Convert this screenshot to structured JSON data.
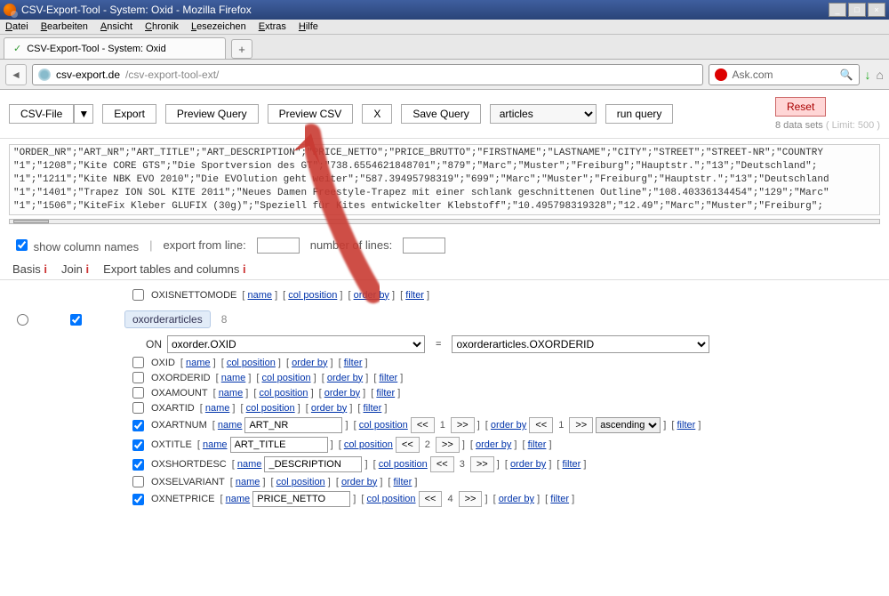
{
  "window_title": "CSV-Export-Tool - System: Oxid - Mozilla Firefox",
  "menu": [
    "Datei",
    "Bearbeiten",
    "Ansicht",
    "Chronik",
    "Lesezeichen",
    "Extras",
    "Hilfe"
  ],
  "tab_title": "CSV-Export-Tool - System: Oxid",
  "url_host": "csv-export.de",
  "url_path": "/csv-export-tool-ext/",
  "search_placeholder": "Ask.com",
  "toolbar": {
    "csv_file": "CSV-File",
    "export": "Export",
    "preview_query": "Preview Query",
    "preview_csv": "Preview CSV",
    "close_x": "X",
    "save_query": "Save Query",
    "target_select": "articles",
    "run_query": "run query",
    "reset": "Reset",
    "data_sets": "8 data sets",
    "limit": "( Limit: 500 )"
  },
  "csv_preview_lines": [
    "\"ORDER_NR\";\"ART_NR\";\"ART_TITLE\";\"ART_DESCRIPTION\";\"PRICE_NETTO\";\"PRICE_BRUTTO\";\"FIRSTNAME\";\"LASTNAME\";\"CITY\";\"STREET\";\"STREET-NR\";\"COUNTRY",
    "\"1\";\"1208\";\"Kite CORE GTS\";\"Die Sportversion des GT\";\"738.6554621848701\";\"879\";\"Marc\";\"Muster\";\"Freiburg\";\"Hauptstr.\";\"13\";\"Deutschland\";",
    "\"1\";\"1211\";\"Kite NBK EVO 2010\";\"Die EVOlution geht weiter\";\"587.39495798319\";\"699\";\"Marc\";\"Muster\";\"Freiburg\";\"Hauptstr.\";\"13\";\"Deutschland",
    "\"1\";\"1401\";\"Trapez ION SOL KITE 2011\";\"Neues Damen Freestyle-Trapez mit einer schlank geschnittenen Outline\";\"108.40336134454\";\"129\";\"Marc\"",
    "\"1\";\"1506\";\"KiteFix Kleber GLUFIX (30g)\";\"Speziell für Kites entwickelter Klebstoff\";\"10.495798319328\";\"12.49\";\"Marc\";\"Muster\";\"Freiburg\";"
  ],
  "show_col_names": "show column names",
  "export_from_line": "export from line:",
  "number_of_lines": "number of lines:",
  "subtabs": {
    "basis": "Basis",
    "join": "Join",
    "export_cols": "Export tables and columns"
  },
  "oxisnettomode": "OXISNETTOMODE",
  "table_chip": "oxorderarticles",
  "table_count": "8",
  "on_label": "ON",
  "on_left": "oxorder.OXID",
  "on_right": "oxorderarticles.OXORDERID",
  "cols": [
    {
      "checked": false,
      "name": "OXID",
      "alias": "",
      "pos": "",
      "ord": false
    },
    {
      "checked": false,
      "name": "OXORDERID",
      "alias": "",
      "pos": "",
      "ord": false
    },
    {
      "checked": false,
      "name": "OXAMOUNT",
      "alias": "",
      "pos": "",
      "ord": false
    },
    {
      "checked": false,
      "name": "OXARTID",
      "alias": "",
      "pos": "",
      "ord": false
    },
    {
      "checked": true,
      "name": "OXARTNUM",
      "alias": "ART_NR",
      "pos": "1",
      "ord": true,
      "order_pos": "1",
      "order_dir": "ascending"
    },
    {
      "checked": true,
      "name": "OXTITLE",
      "alias": "ART_TITLE",
      "pos": "2",
      "ord": false
    },
    {
      "checked": true,
      "name": "OXSHORTDESC",
      "alias": "_DESCRIPTION",
      "pos": "3",
      "ord": false
    },
    {
      "checked": false,
      "name": "OXSELVARIANT",
      "alias": "",
      "pos": "",
      "ord": false
    },
    {
      "checked": true,
      "name": "OXNETPRICE",
      "alias": "PRICE_NETTO",
      "pos": "4",
      "ord": false
    }
  ],
  "lnk": {
    "name": "name",
    "col_position": "col position",
    "order_by": "order by",
    "filter": "filter"
  }
}
